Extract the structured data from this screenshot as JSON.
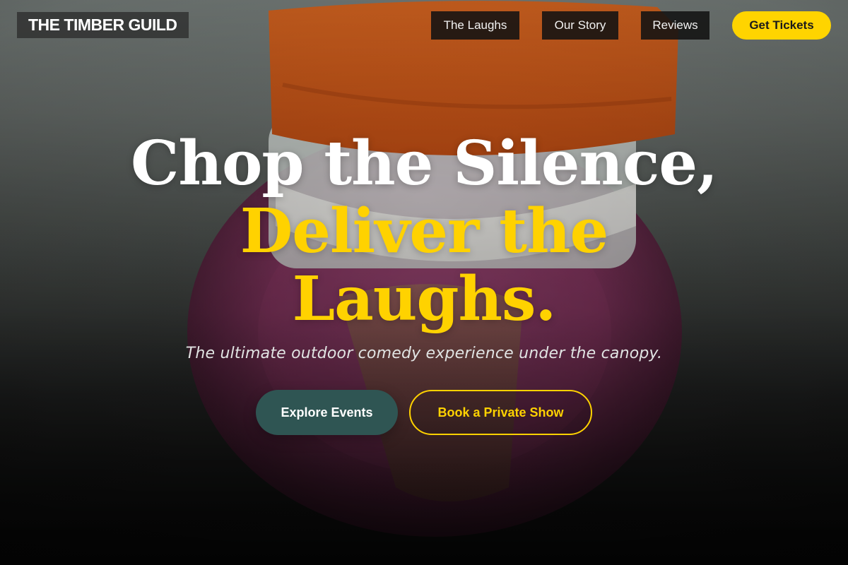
{
  "site": {
    "logo": "THE TIMBER GUILD"
  },
  "nav": {
    "links": [
      "The Laughs",
      "Our Story",
      "Reviews"
    ],
    "cta": "Get Tickets"
  },
  "hero": {
    "headline_line1": "Chop the Silence,",
    "headline_line2": "Deliver the",
    "headline_line3": "Laughs.",
    "subtitle": "The ultimate outdoor comedy experience under the canopy.",
    "primary_button": "Explore Events",
    "secondary_button": "Book a Private Show"
  },
  "colors": {
    "accent": "#ffd200",
    "primary_button": "#2f5553",
    "nav_bg": "#121212"
  }
}
